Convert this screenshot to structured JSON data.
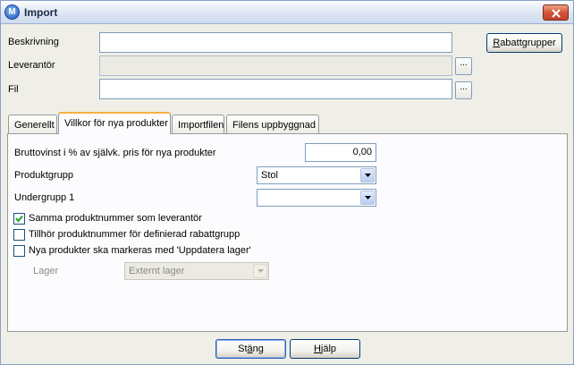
{
  "window": {
    "title": "Import",
    "app_icon_letter": "M"
  },
  "form": {
    "beskrivning_label": "Beskrivning",
    "beskrivning_value": "",
    "leverantor_label": "Leverantör",
    "leverantor_value": "",
    "fil_label": "Fil",
    "fil_value": "",
    "browse_label": "...",
    "rabattgrupper_label_first": "R",
    "rabattgrupper_label_rest": "abattgrupper"
  },
  "tabs": [
    {
      "label": "Generellt"
    },
    {
      "label": "Villkor för nya produkter"
    },
    {
      "label": "Importfilen"
    },
    {
      "label": "Filens uppbyggnad"
    }
  ],
  "panel": {
    "bruttovinst_label": "Bruttovinst i % av självk. pris för nya produkter",
    "bruttovinst_value": "0,00",
    "produktgrupp_label": "Produktgrupp",
    "produktgrupp_value": "Stol",
    "undergrupp_label": "Undergrupp 1",
    "undergrupp_value": "",
    "checkboxes": [
      {
        "label": "Samma produktnummer som leverantör",
        "checked": true
      },
      {
        "label": "Tillhör produktnummer för definierad rabattgrupp",
        "checked": false
      },
      {
        "label": "Nya produkter ska markeras med 'Uppdatera lager'",
        "checked": false
      }
    ],
    "lager_label": "Lager",
    "lager_value": "Externt lager"
  },
  "footer": {
    "stang_first": "St",
    "stang_u": "ä",
    "stang_rest": "ng",
    "hjalp_first": "H",
    "hjalp_rest": "jälp"
  }
}
